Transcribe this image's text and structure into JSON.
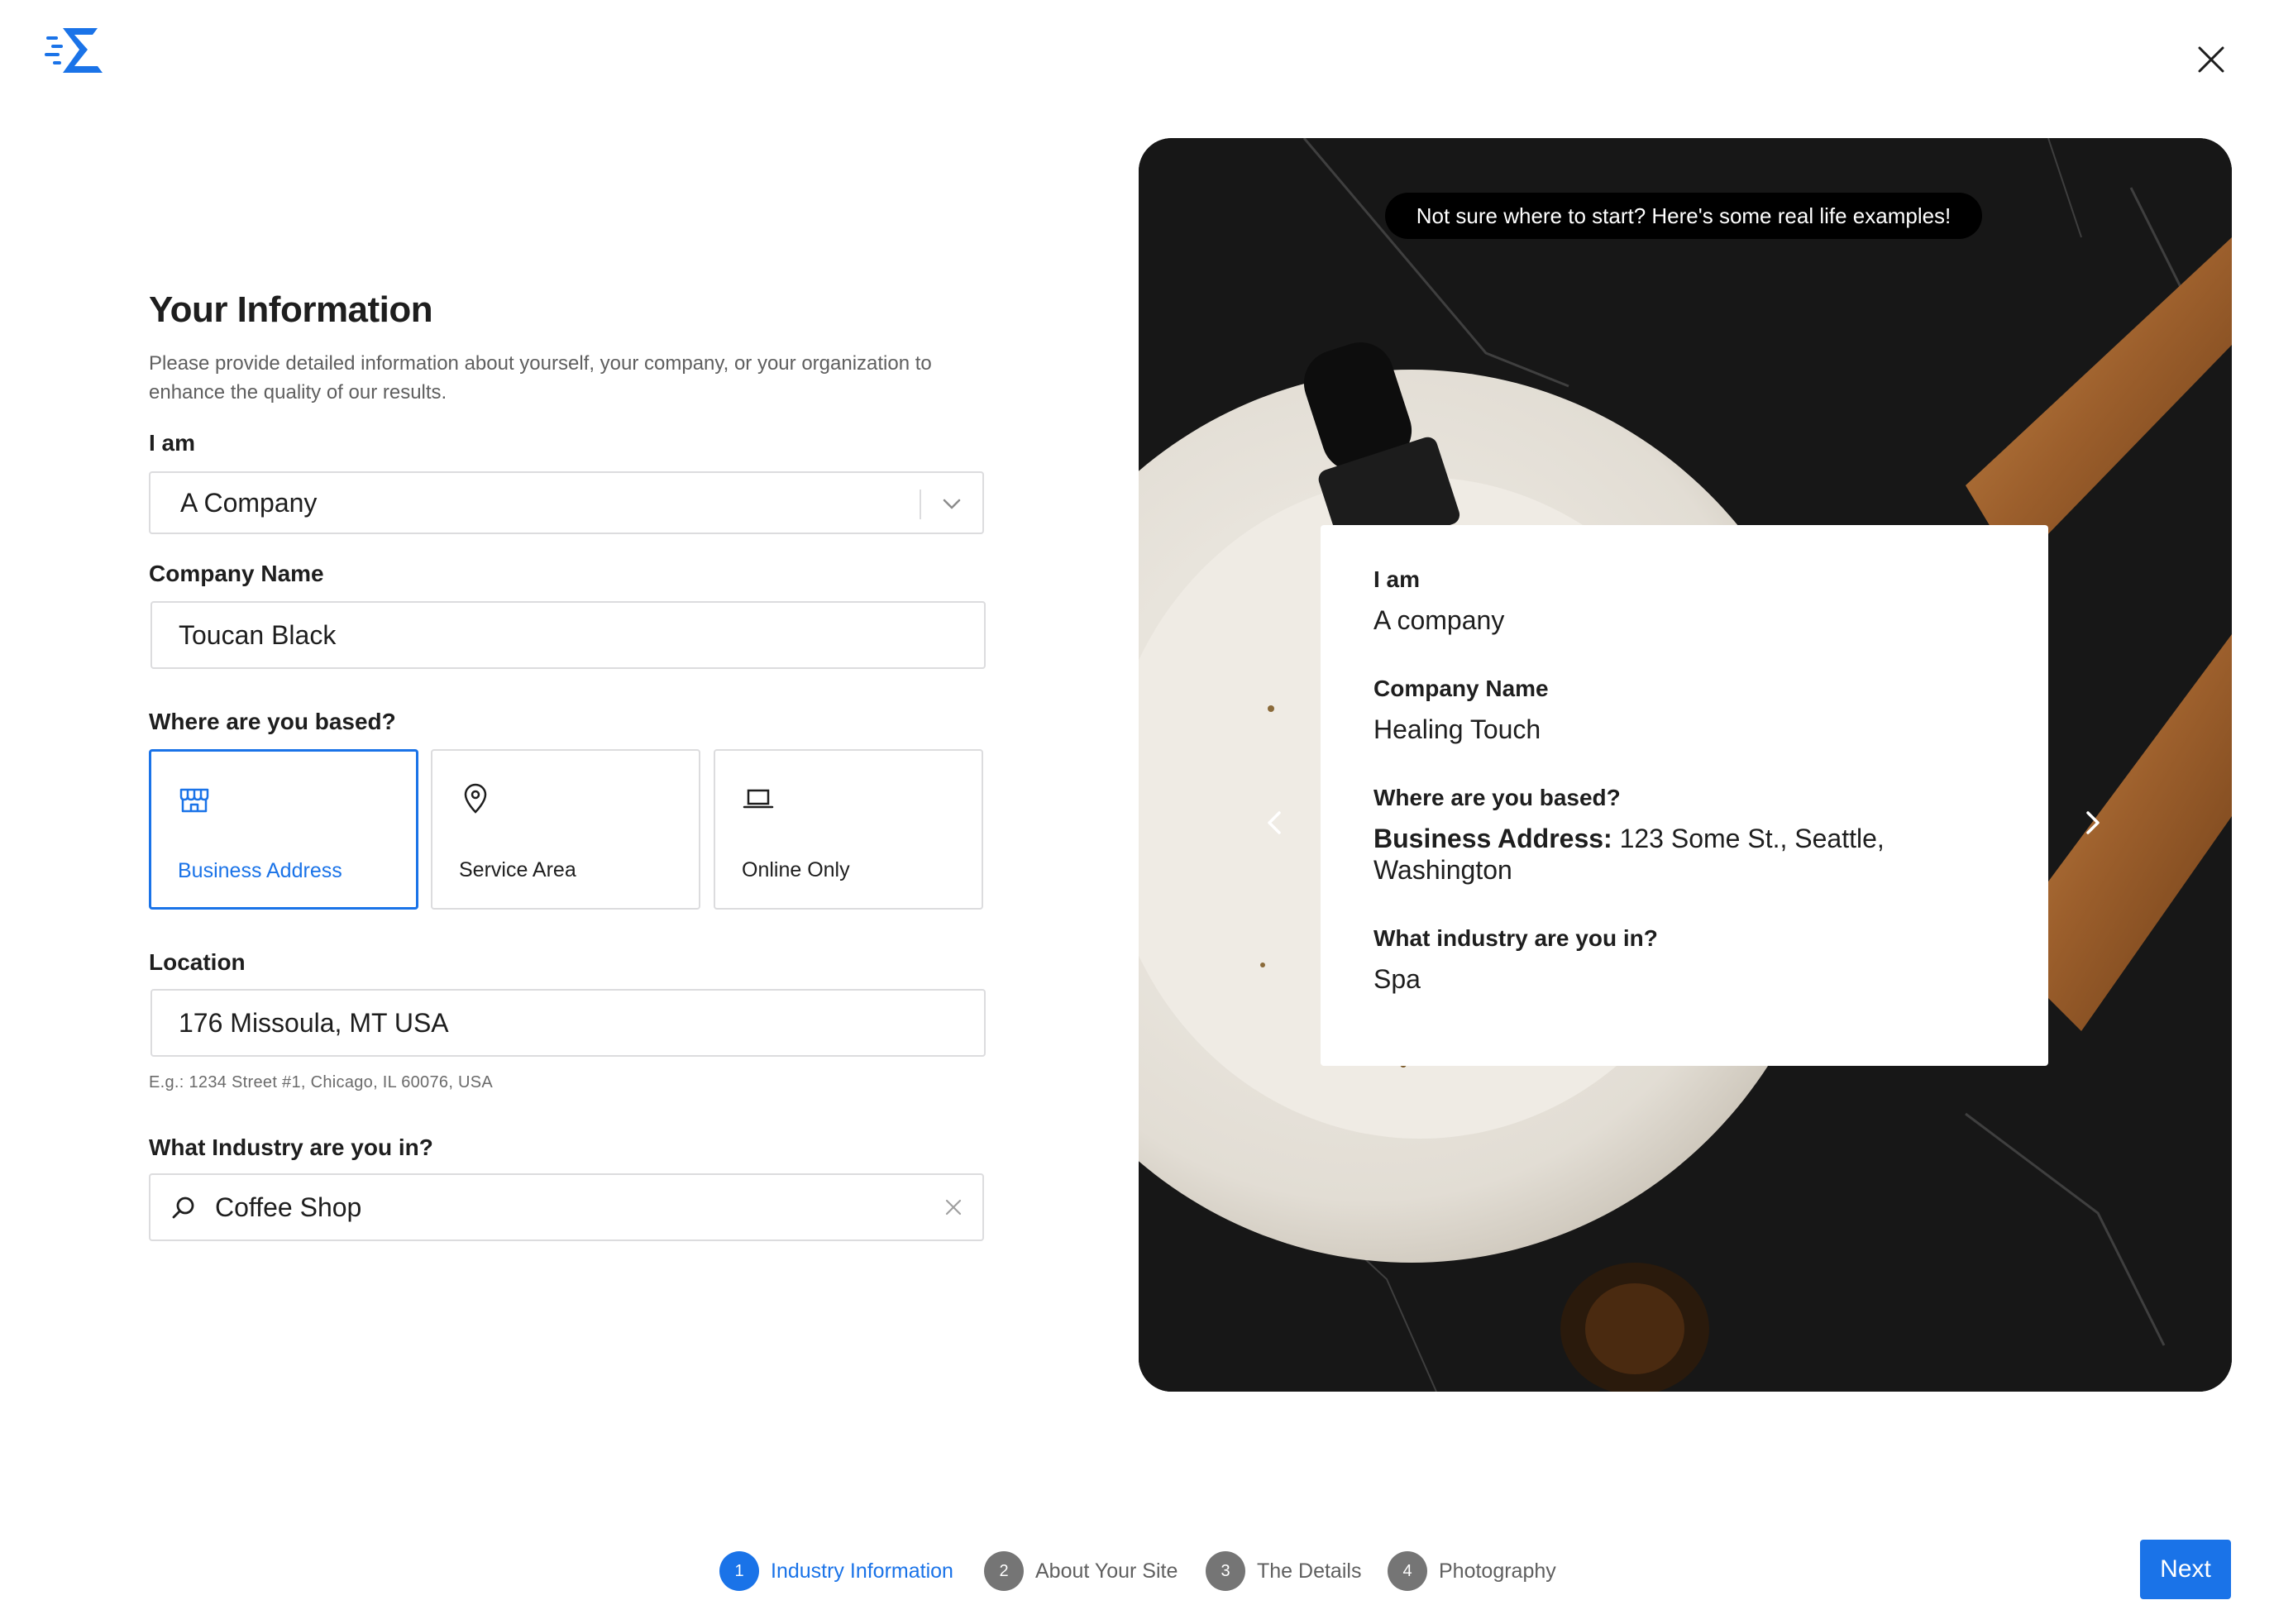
{
  "header": {
    "logo_icon": "brand-logo-icon",
    "close_icon": "close-icon"
  },
  "form": {
    "title": "Your Information",
    "subtitle": "Please provide detailed information about yourself, your company, or your organization to enhance the quality of our results.",
    "i_am": {
      "label": "I am",
      "value": "A Company"
    },
    "company_name": {
      "label": "Company Name",
      "value": "Toucan Black"
    },
    "based": {
      "label": "Where are you based?",
      "options": [
        {
          "label": "Business Address",
          "icon": "storefront-icon",
          "selected": true
        },
        {
          "label": "Service Area",
          "icon": "map-pin-icon",
          "selected": false
        },
        {
          "label": "Online Only",
          "icon": "laptop-icon",
          "selected": false
        }
      ]
    },
    "location": {
      "label": "Location",
      "value": "176 Missoula, MT USA",
      "hint": "E.g.: 1234 Street #1, Chicago, IL 60076, USA"
    },
    "industry": {
      "label": "What Industry are you in?",
      "value": "Coffee Shop"
    }
  },
  "examples": {
    "banner": "Not sure where to start? Here's some real life examples!",
    "card": {
      "i_am_label": "I am",
      "i_am_value": "A company",
      "company_label": "Company Name",
      "company_value": "Healing Touch",
      "based_label": "Where are you based?",
      "based_prefix": "Business Address:",
      "based_value": "123 Some St., Seattle, Washington",
      "industry_label": "What industry are you in?",
      "industry_value": "Spa"
    }
  },
  "steps": [
    {
      "num": "1",
      "label": "Industry Information",
      "active": true
    },
    {
      "num": "2",
      "label": "About Your Site",
      "active": false
    },
    {
      "num": "3",
      "label": "The Details",
      "active": false
    },
    {
      "num": "4",
      "label": "Photography",
      "active": false
    }
  ],
  "next_label": "Next",
  "colors": {
    "accent": "#1a73e8",
    "text": "#1e1e1e",
    "border": "#dcdcde"
  }
}
